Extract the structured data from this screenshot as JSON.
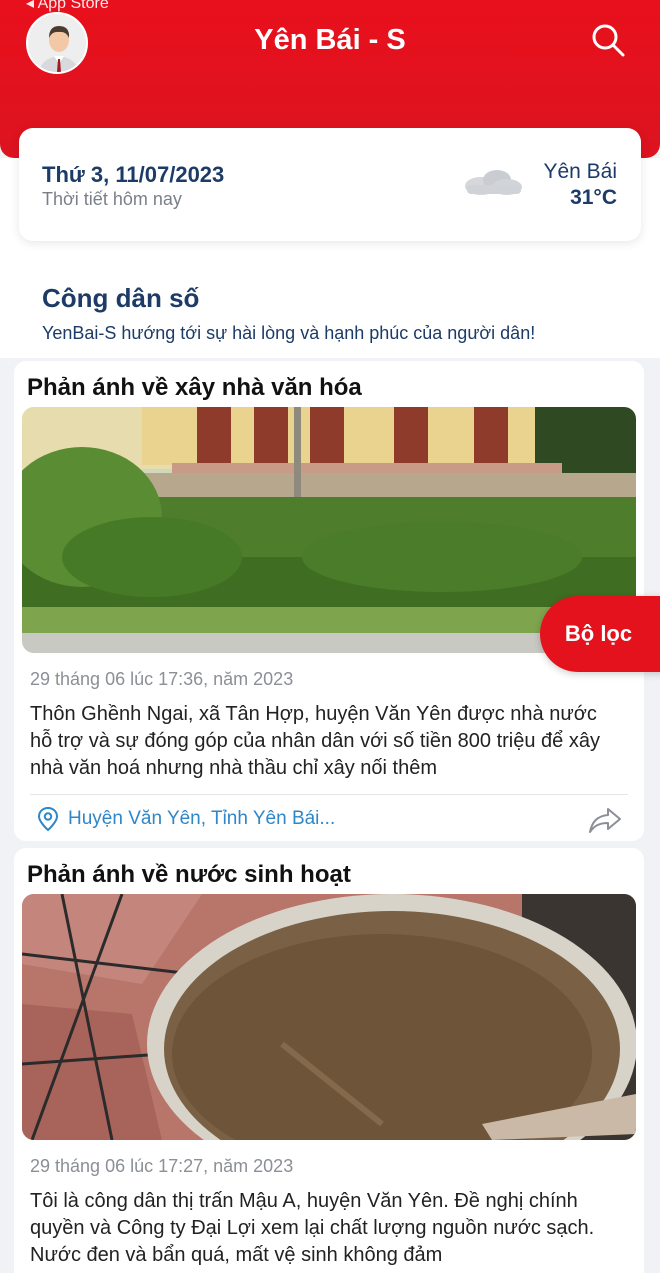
{
  "status_bar": {
    "back_label": "◂ App Store"
  },
  "header": {
    "title": "Yên Bái - S"
  },
  "weather": {
    "date": "Thứ 3, 11/07/2023",
    "subtitle": "Thời tiết hôm nay",
    "location": "Yên Bái",
    "temperature": "31°C",
    "icon": "cloud-icon"
  },
  "section": {
    "title": "Công dân số",
    "subtitle": "YenBai-S hướng tới sự hài lòng và hạnh phúc của người dân!"
  },
  "filter_button": {
    "label": "Bộ lọc"
  },
  "posts": [
    {
      "title": "Phản ánh về xây nhà văn hóa",
      "date": "29 tháng 06 lúc 17:36, năm 2023",
      "body": "Thôn Ghềnh Ngai, xã Tân Hợp, huyện Văn Yên được nhà nước hỗ trợ và sự đóng góp của nhân dân với số tiền 800 triệu để xây nhà văn hoá nhưng nhà thầu chỉ xây nối thêm",
      "location": "Huyện Văn Yên, Tỉnh Yên Bái..."
    },
    {
      "title": "Phản ánh về nước sinh hoạt",
      "date": "29 tháng 06 lúc 17:27, năm 2023",
      "body": "Tôi là công dân thị trấn Mậu A, huyện Văn Yên.  Đề nghị chính quyền và Công ty Đại Lợi xem lại chất lượng nguồn nước sạch. Nước đen và bẩn quá, mất vệ sinh không đảm"
    }
  ],
  "colors": {
    "brand_red": "#e3121c",
    "navy": "#1c3b66",
    "link_blue": "#2f86c8"
  }
}
